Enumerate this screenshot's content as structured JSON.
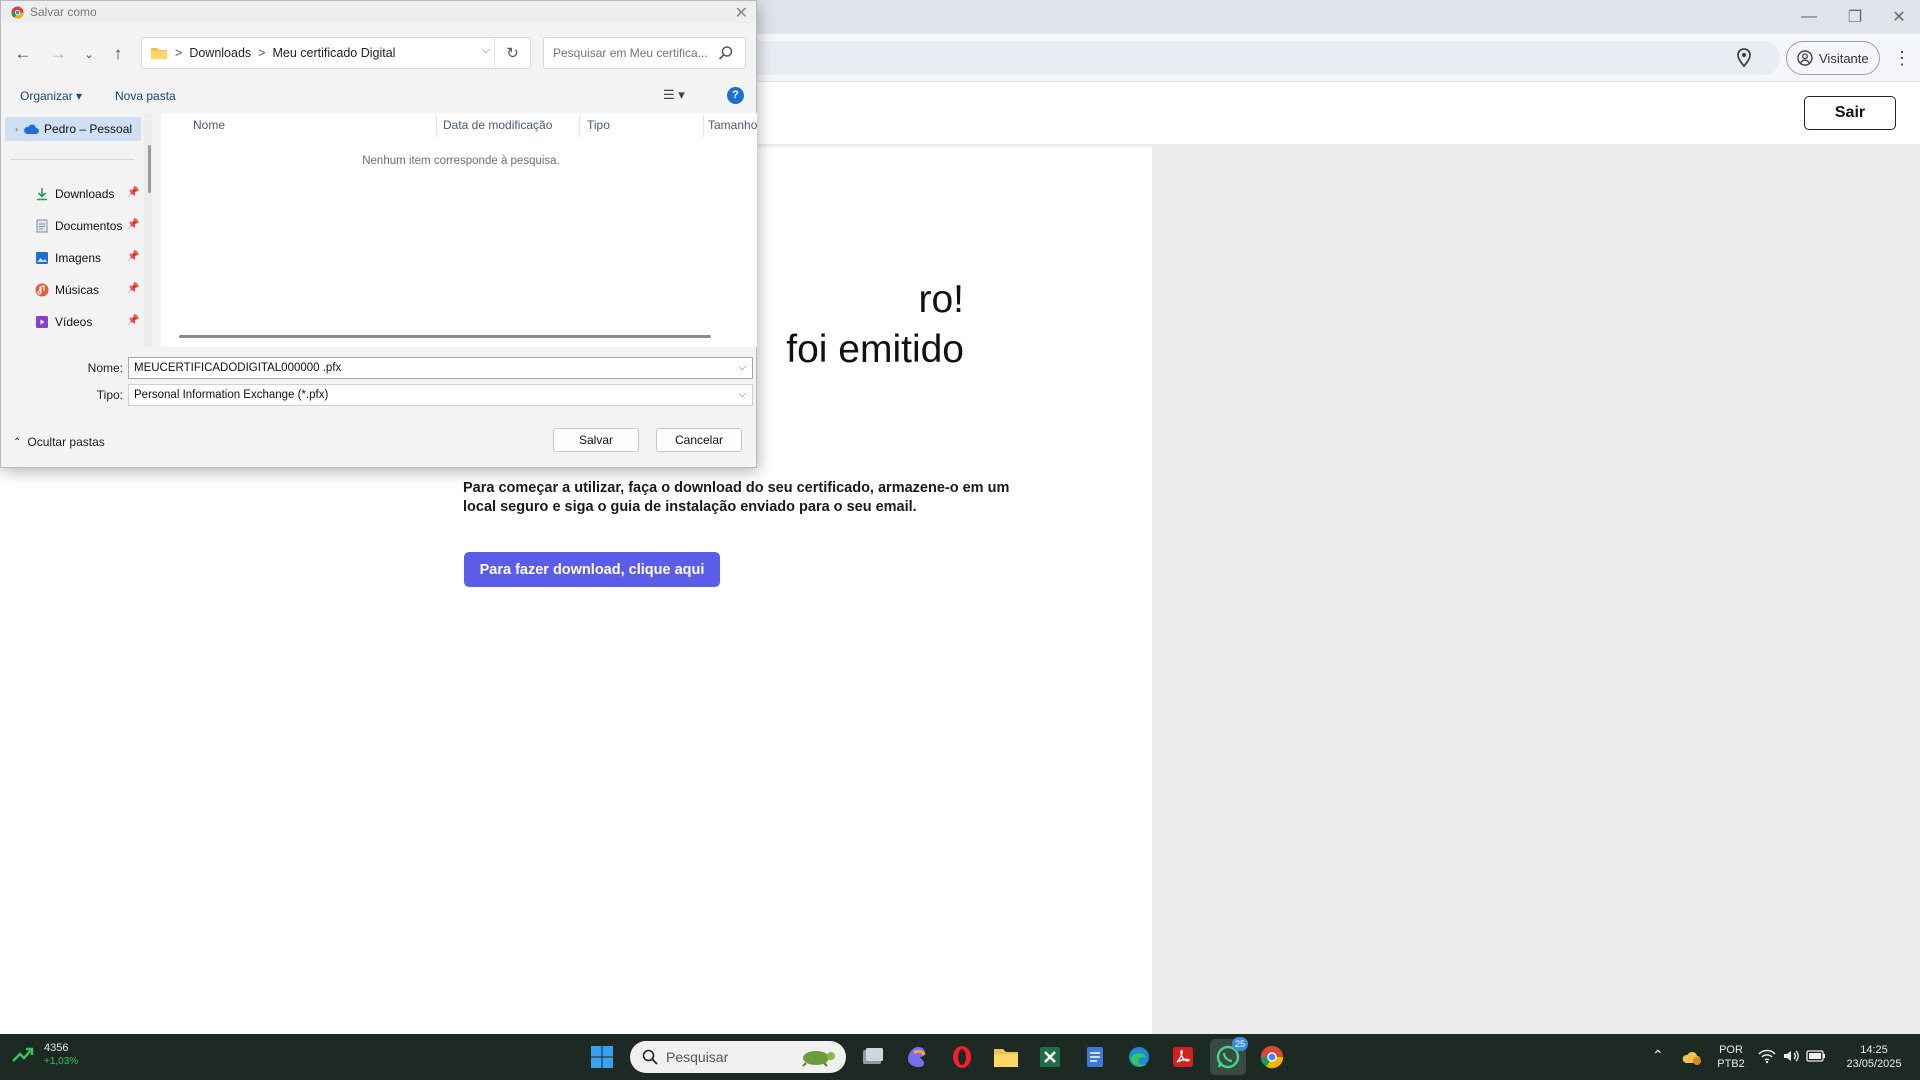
{
  "browser": {
    "visitor_label": "Visitante",
    "window_controls": {
      "minimize": "—",
      "maximize": "❐",
      "close": "✕"
    },
    "menu_glyph": "⋮"
  },
  "page": {
    "logout_label": "Sair",
    "heading_line1": "ro!",
    "heading_line2": "foi emitido",
    "description": "Para começar a utilizar, faça o download do seu certificado, armazene-o em um local seguro e siga o guia de instalação enviado para o seu email.",
    "download_button": "Para fazer download, clique aqui",
    "accent_color": "#5b5ce8"
  },
  "dialog": {
    "title": "Salvar como",
    "breadcrumb": [
      "Downloads",
      "Meu certificado Digital"
    ],
    "breadcrumb_sep": ">",
    "search_placeholder": "Pesquisar em Meu certifica...",
    "organize_label": "Organizar",
    "new_folder_label": "Nova pasta",
    "sidebar": {
      "selected": "Pedro – Pessoal",
      "items": [
        {
          "label": "Downloads",
          "icon": "download-icon"
        },
        {
          "label": "Documentos",
          "icon": "document-icon"
        },
        {
          "label": "Imagens",
          "icon": "pictures-icon"
        },
        {
          "label": "Músicas",
          "icon": "music-icon"
        },
        {
          "label": "Vídeos",
          "icon": "videos-icon"
        }
      ]
    },
    "columns": [
      "Nome",
      "Data de modificação",
      "Tipo",
      "Tamanho"
    ],
    "empty_message": "Nenhum item corresponde à pesquisa.",
    "name_label": "Nome:",
    "name_value": "MEUCERTIFICADODIGITAL000000 .pfx",
    "type_label": "Tipo:",
    "type_value": "Personal Information Exchange (*.pfx)",
    "hide_folders_label": "Ocultar pastas",
    "save_button": "Salvar",
    "cancel_button": "Cancelar"
  },
  "taskbar": {
    "stock_value": "4356",
    "stock_change": "+1,03%",
    "search_placeholder": "Pesquisar",
    "language_line1": "POR",
    "language_line2": "PTB2",
    "time": "14:25",
    "date": "23/05/2025",
    "whatsapp_badge": "25"
  }
}
